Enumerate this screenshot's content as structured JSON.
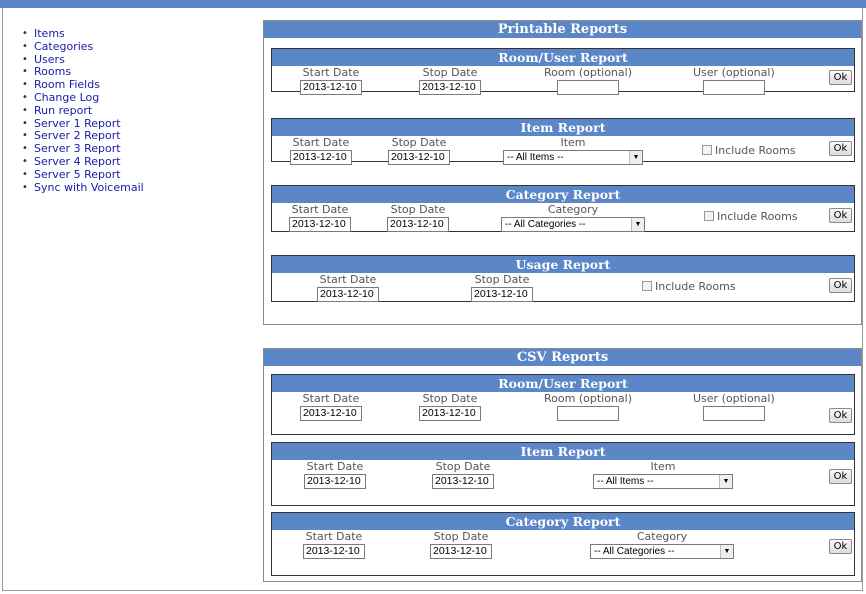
{
  "nav": [
    "Items",
    "Categories",
    "Users",
    "Rooms",
    "Room Fields",
    "Change Log",
    "Run report",
    "Server 1 Report",
    "Server 2 Report",
    "Server 3 Report",
    "Server 4 Report",
    "Server 5 Report",
    "Sync with Voicemail"
  ],
  "printable": {
    "title": "Printable Reports",
    "room_user": {
      "title": "Room/User Report",
      "start_label": "Start Date",
      "stop_label": "Stop Date",
      "room_label": "Room (optional)",
      "user_label": "User (optional)",
      "start_value": "2013-12-10",
      "stop_value": "2013-12-10",
      "room_value": "",
      "user_value": "",
      "ok": "Ok"
    },
    "item": {
      "title": "Item Report",
      "start_label": "Start Date",
      "stop_label": "Stop Date",
      "item_label": "Item",
      "start_value": "2013-12-10",
      "stop_value": "2013-12-10",
      "item_selected": "-- All Items --",
      "include_rooms": "Include Rooms",
      "ok": "Ok"
    },
    "category": {
      "title": "Category Report",
      "start_label": "Start Date",
      "stop_label": "Stop Date",
      "category_label": "Category",
      "start_value": "2013-12-10",
      "stop_value": "2013-12-10",
      "category_selected": "-- All Categories --",
      "include_rooms": "Include Rooms",
      "ok": "Ok"
    },
    "usage": {
      "title": "Usage Report",
      "start_label": "Start Date",
      "stop_label": "Stop Date",
      "start_value": "2013-12-10",
      "stop_value": "2013-12-10",
      "include_rooms": "Include Rooms",
      "ok": "Ok"
    }
  },
  "csv": {
    "title": "CSV Reports",
    "room_user": {
      "title": "Room/User Report",
      "start_label": "Start Date",
      "stop_label": "Stop Date",
      "room_label": "Room (optional)",
      "user_label": "User (optional)",
      "start_value": "2013-12-10",
      "stop_value": "2013-12-10",
      "room_value": "",
      "user_value": "",
      "ok": "Ok"
    },
    "item": {
      "title": "Item Report",
      "start_label": "Start Date",
      "stop_label": "Stop Date",
      "item_label": "Item",
      "start_value": "2013-12-10",
      "stop_value": "2013-12-10",
      "item_selected": "-- All Items --",
      "ok": "Ok"
    },
    "category": {
      "title": "Category Report",
      "start_label": "Start Date",
      "stop_label": "Stop Date",
      "category_label": "Category",
      "start_value": "2013-12-10",
      "stop_value": "2013-12-10",
      "category_selected": "-- All Categories --",
      "ok": "Ok"
    }
  }
}
